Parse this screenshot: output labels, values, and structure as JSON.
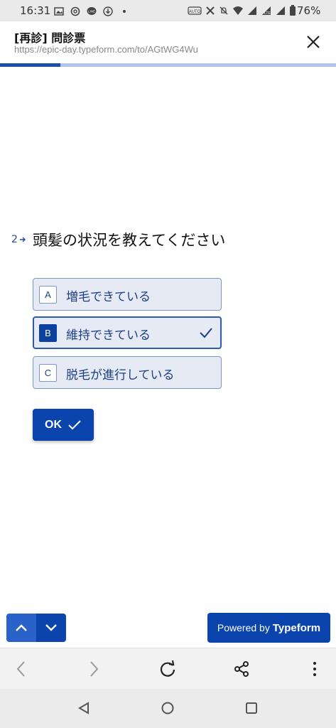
{
  "status_bar": {
    "time": "16:31",
    "battery": "76%"
  },
  "header": {
    "title": "[再診] 問診票",
    "url": "https://epic-day.typeform.com/to/AGtWG4Wu"
  },
  "progress": {
    "fraction": 0.18
  },
  "question": {
    "number": "2",
    "text": "頭髪の状況を教えてください",
    "choices": [
      {
        "key": "A",
        "label": "増毛できている",
        "selected": false
      },
      {
        "key": "B",
        "label": "維持できている",
        "selected": true
      },
      {
        "key": "C",
        "label": "脱毛が進行している",
        "selected": false
      }
    ],
    "ok_label": "OK"
  },
  "footer": {
    "powered_prefix": "Powered by",
    "powered_brand": "Typeform"
  },
  "colors": {
    "accent": "#0b44ad",
    "choice_bg": "#e5eaf4",
    "choice_text": "#1d3f84"
  },
  "icons": {
    "nav_up": "chevron-up-icon",
    "nav_down": "chevron-down-icon",
    "close": "close-icon",
    "check": "check-icon"
  }
}
